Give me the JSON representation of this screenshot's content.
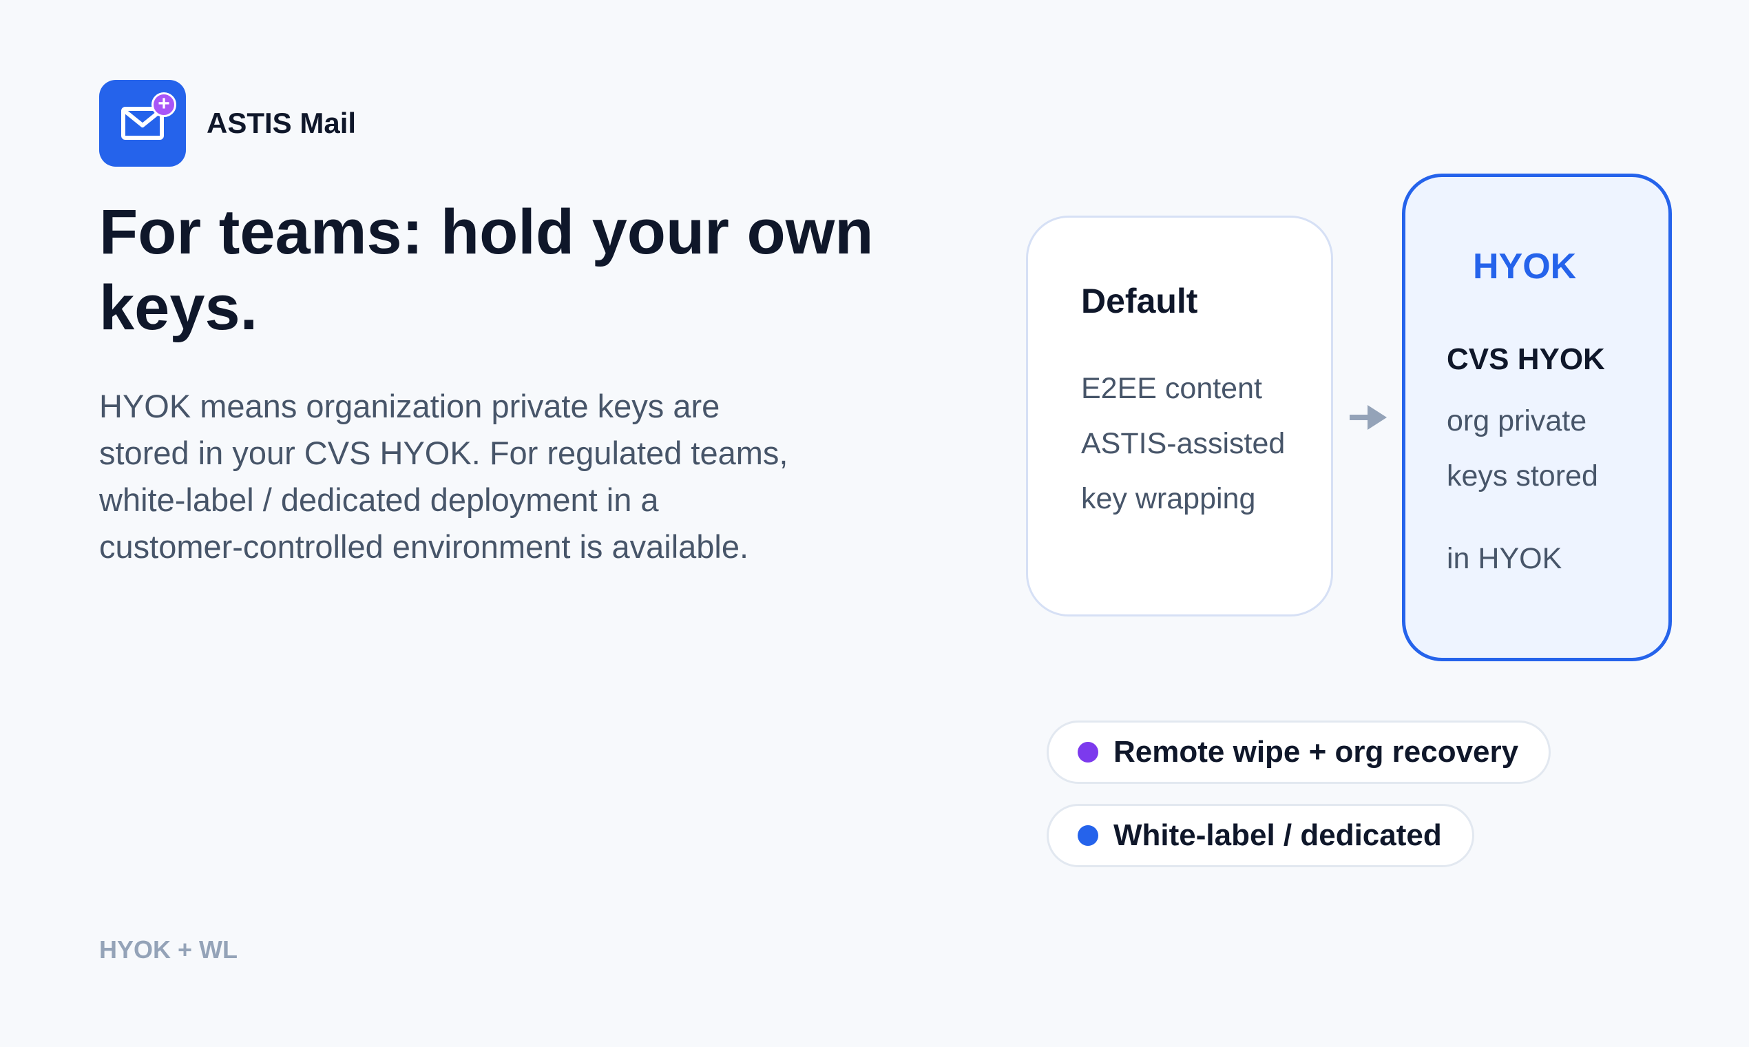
{
  "brand": {
    "name": "ASTIS Mail",
    "logo_icon": "mail-plus-icon",
    "accent": "#2563eb",
    "badge_color": "#a855f7"
  },
  "hero": {
    "headline": "For teams: hold your own keys.",
    "body": "HYOK means organization private keys are stored in your CVS HYOK. For regulated teams, white-label / dedicated deployment in a customer-controlled environment is available."
  },
  "flow": {
    "default_card": {
      "title": "Default",
      "lines": [
        "E2EE content",
        "ASTIS-assisted",
        "key wrapping"
      ]
    },
    "arrow_icon": "arrow-right-icon",
    "hyok_card": {
      "tag": "HYOK",
      "subtitle": "CVS HYOK",
      "lines": [
        "org private",
        "keys stored",
        "in HYOK"
      ]
    }
  },
  "features": [
    {
      "label": "Remote wipe + org recovery",
      "dot_color": "#7c3aed"
    },
    {
      "label": "White-label / dedicated",
      "dot_color": "#2563eb"
    }
  ],
  "footer": {
    "tag": "HYOK + WL"
  }
}
